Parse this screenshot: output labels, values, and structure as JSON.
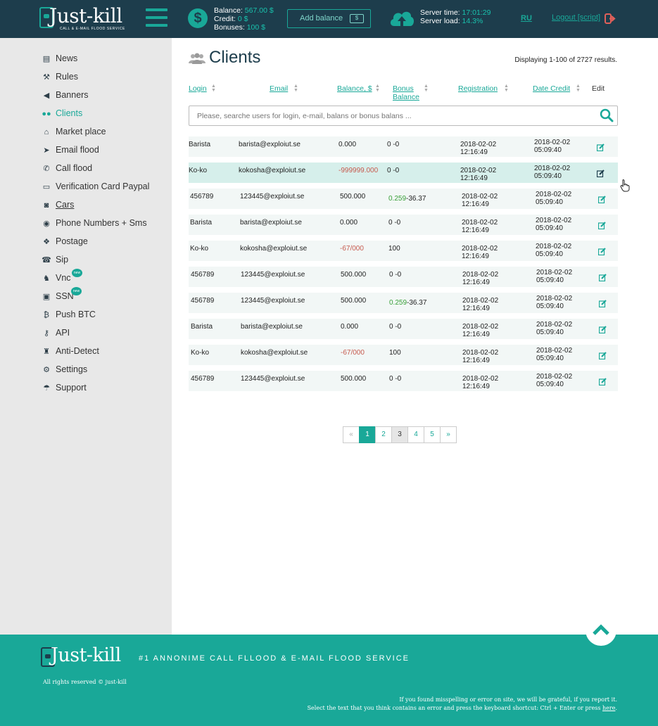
{
  "header": {
    "logo_text": "Just-kill",
    "logo_sub": "CALL & E-MAIL FLOOD SERVICE",
    "balance_label": "Balance:",
    "balance_value": "567.00 $",
    "credit_label": "Credit:",
    "credit_value": "0 $",
    "bonuses_label": "Bonuses:",
    "bonuses_value": "100 $",
    "add_balance_label": "Add balance",
    "server_time_label": "Server time:",
    "server_time_value": "17:01:29",
    "server_load_label": "Server load:",
    "server_load_value": "14.3%",
    "lang": "RU",
    "logout": "Logout [script]"
  },
  "sidebar": {
    "items": [
      {
        "label": "News",
        "icon": "newspaper-icon"
      },
      {
        "label": "Rules",
        "icon": "gavel-icon"
      },
      {
        "label": "Banners",
        "icon": "megaphone-icon"
      },
      {
        "label": "Clients",
        "icon": "users-icon"
      },
      {
        "label": "Market place",
        "icon": "basket-icon"
      },
      {
        "label": "Email flood",
        "icon": "paper-plane-icon"
      },
      {
        "label": "Call flood",
        "icon": "phone-icon"
      },
      {
        "label": "Verification Card Paypal",
        "icon": "credit-card-icon"
      },
      {
        "label": "Cars",
        "icon": "car-icon"
      },
      {
        "label": "Phone Numbers + Sms",
        "icon": "chat-icon"
      },
      {
        "label": "Postage",
        "icon": "dropbox-icon"
      },
      {
        "label": "Sip",
        "icon": "phone-volume-icon"
      },
      {
        "label": "Vnc",
        "icon": "android-icon",
        "badge": "new"
      },
      {
        "label": "SSN",
        "icon": "id-card-icon",
        "badge": "new"
      },
      {
        "label": "Push BTC",
        "icon": "bitcoin-icon"
      },
      {
        "label": "API",
        "icon": "key-icon"
      },
      {
        "label": "Anti-Detect",
        "icon": "user-secret-icon"
      },
      {
        "label": "Settings",
        "icon": "gear-icon"
      },
      {
        "label": "Support",
        "icon": "umbrella-icon"
      }
    ],
    "active": "Clients"
  },
  "main": {
    "title": "Clients",
    "summary": "Displaying 1-100 of 2727 results.",
    "columns": {
      "login": "Login",
      "email": "Email",
      "balance": "Balance, $",
      "bonus": "Bonus Balance",
      "registration": "Registration",
      "date_credit": "Date Credit",
      "edit": "Edit"
    },
    "search_placeholder": "Please, searche users for login, e-mail, balans or bonus balans ...",
    "rows": [
      {
        "login": "Barista",
        "email": "barista@exploiut.se",
        "balance": "0.000",
        "bonus_a": "",
        "bonus_b": "0 -0",
        "reg_date": "2018-02-02",
        "reg_time": "12:16:49",
        "credit_date": "2018-02-02",
        "credit_time": "05:09:40"
      },
      {
        "login": "Ko-ko",
        "email": "kokosha@exploiut.se",
        "balance": "-999999.000",
        "bonus_a": "",
        "bonus_b": "0 -0",
        "reg_date": "2018-02-02",
        "reg_time": "12:16:49",
        "credit_date": "2018-02-02",
        "credit_time": "05:09:40"
      },
      {
        "login": "456789",
        "email": "123445@exploiut.se",
        "balance": "500.000",
        "bonus_a": "0.259",
        "bonus_b": "-36.37",
        "reg_date": "2018-02-02",
        "reg_time": "12:16:49",
        "credit_date": "2018-02-02",
        "credit_time": "05:09:40"
      },
      {
        "login": "Barista",
        "email": "barista@exploiut.se",
        "balance": "0.000",
        "bonus_a": "",
        "bonus_b": "0 -0",
        "reg_date": "2018-02-02",
        "reg_time": "12:16:49",
        "credit_date": "2018-02-02",
        "credit_time": "05:09:40"
      },
      {
        "login": "Ko-ko",
        "email": "kokosha@exploiut.se",
        "balance": "-67/000",
        "bonus_a": "",
        "bonus_b": "100",
        "reg_date": "2018-02-02",
        "reg_time": "12:16:49",
        "credit_date": "2018-02-02",
        "credit_time": "05:09:40"
      },
      {
        "login": "456789",
        "email": "123445@exploiut.se",
        "balance": "500.000",
        "bonus_a": "",
        "bonus_b": "0 -0",
        "reg_date": "2018-02-02",
        "reg_time": "12:16:49",
        "credit_date": "2018-02-02",
        "credit_time": "05:09:40"
      },
      {
        "login": "456789",
        "email": "123445@exploiut.se",
        "balance": "500.000",
        "bonus_a": "0.259",
        "bonus_b": "-36.37",
        "reg_date": "2018-02-02",
        "reg_time": "12:16:49",
        "credit_date": "2018-02-02",
        "credit_time": "05:09:40"
      },
      {
        "login": "Barista",
        "email": "barista@exploiut.se",
        "balance": "0.000",
        "bonus_a": "",
        "bonus_b": "0 -0",
        "reg_date": "2018-02-02",
        "reg_time": "12:16:49",
        "credit_date": "2018-02-02",
        "credit_time": "05:09:40"
      },
      {
        "login": "Ko-ko",
        "email": "kokosha@exploiut.se",
        "balance": "-67/000",
        "bonus_a": "",
        "bonus_b": "100",
        "reg_date": "2018-02-02",
        "reg_time": "12:16:49",
        "credit_date": "2018-02-02",
        "credit_time": "05:09:40"
      },
      {
        "login": "456789",
        "email": "123445@exploiut.se",
        "balance": "500.000",
        "bonus_a": "",
        "bonus_b": "0 -0",
        "reg_date": "2018-02-02",
        "reg_time": "12:16:49",
        "credit_date": "2018-02-02",
        "credit_time": "05:09:40"
      }
    ],
    "pager": [
      "«",
      "1",
      "2",
      "3",
      "4",
      "5",
      "»"
    ],
    "current_page": "1"
  },
  "footer": {
    "logo_text": "Just-kill",
    "tagline": "#1 ANNONIME CALL FLLOOD & E-MAIL FLOOD SERVICE",
    "rights": "All rights reserved © just-kill",
    "report_line1": "If you found misspelling or error on site, we will be grateful, if you report it.",
    "report_line2": "Select the text that you think contains an error and press the keyboard shortcut: Ctrl + Enter or press",
    "report_link": "here"
  },
  "colors": {
    "accent": "#19a898",
    "header_bg": "#1d3d4c",
    "negative": "#c65a4e",
    "positive": "#3aa03a"
  }
}
